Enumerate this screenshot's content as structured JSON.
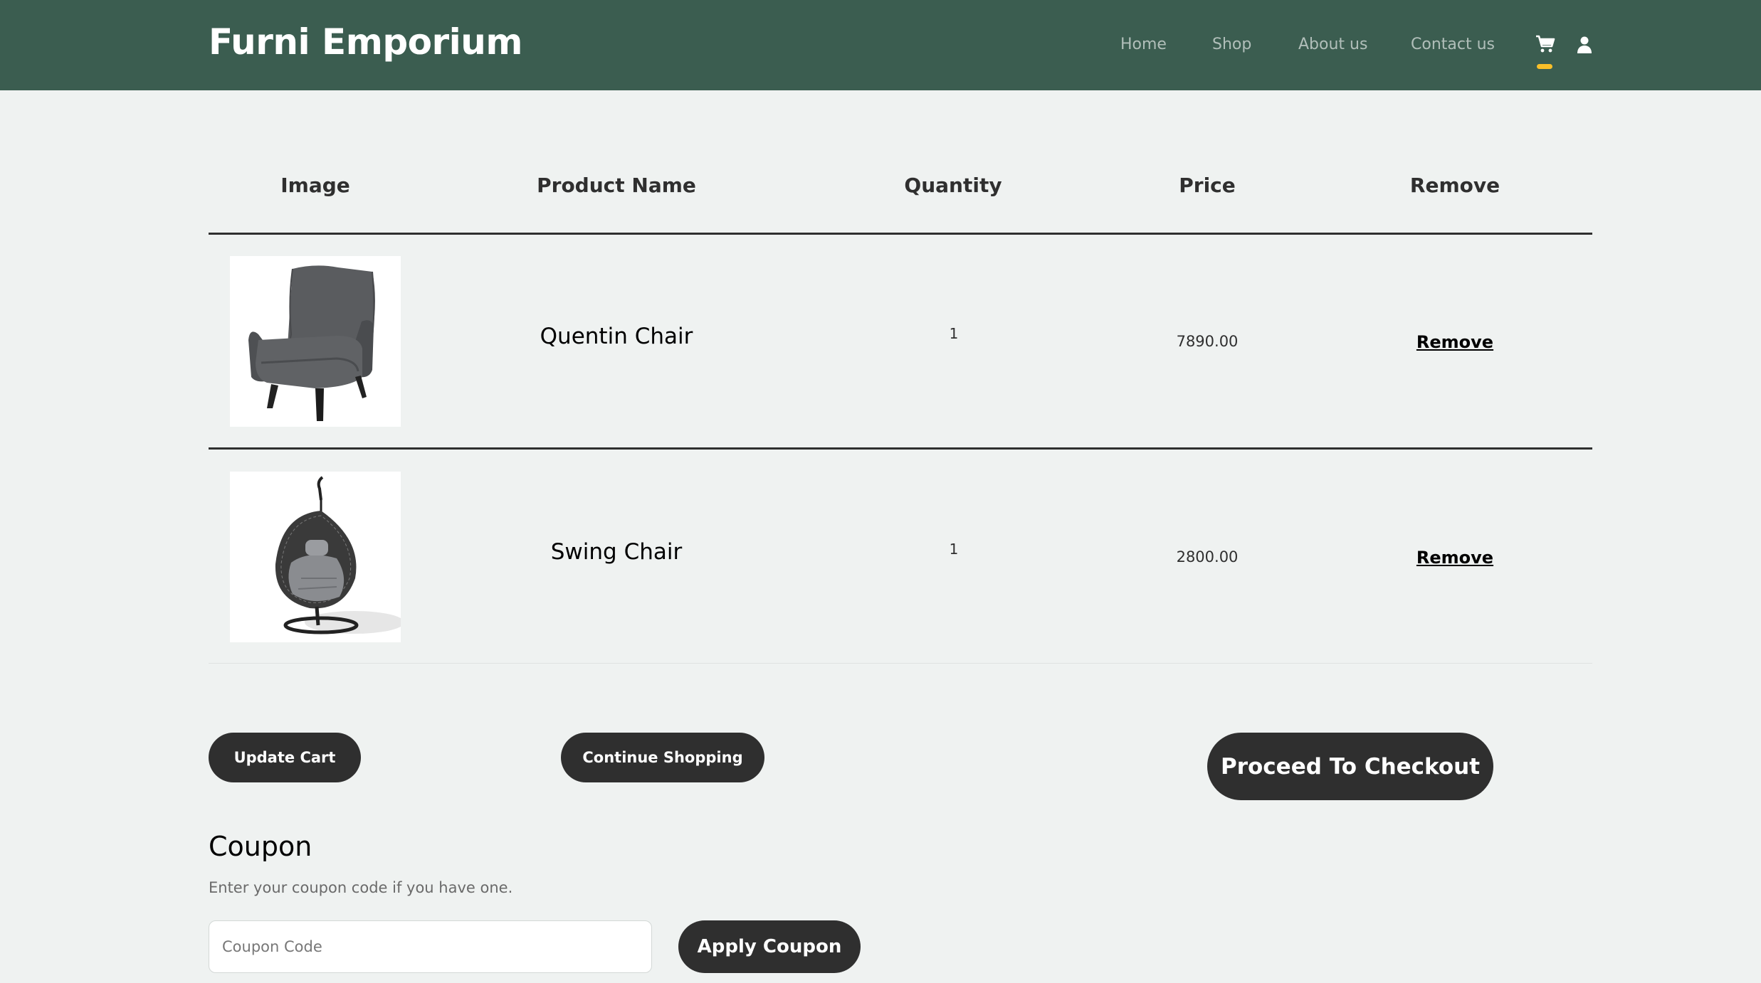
{
  "header": {
    "brand": "Furni Emporium",
    "nav": {
      "home": "Home",
      "shop": "Shop",
      "about": "About us",
      "contact": "Contact us"
    },
    "icons": [
      "cart-icon",
      "user-icon"
    ],
    "accent_color": "#f9bf29",
    "background_color": "#3b5d50"
  },
  "table": {
    "headers": {
      "image": "Image",
      "product_name": "Product Name",
      "quantity": "Quantity",
      "price": "Price",
      "remove": "Remove"
    },
    "rows": [
      {
        "product_name": "Quentin Chair",
        "quantity": "1",
        "price": "7890.00",
        "remove_label": "Remove"
      },
      {
        "product_name": "Swing Chair",
        "quantity": "1",
        "price": "2800.00",
        "remove_label": "Remove"
      }
    ]
  },
  "actions": {
    "update_cart": "Update Cart",
    "continue_shopping": "Continue Shopping",
    "checkout": "Proceed To Checkout"
  },
  "coupon": {
    "title": "Coupon",
    "description": "Enter your coupon code if you have one.",
    "placeholder": "Coupon Code",
    "value": "",
    "apply_label": "Apply Coupon"
  }
}
